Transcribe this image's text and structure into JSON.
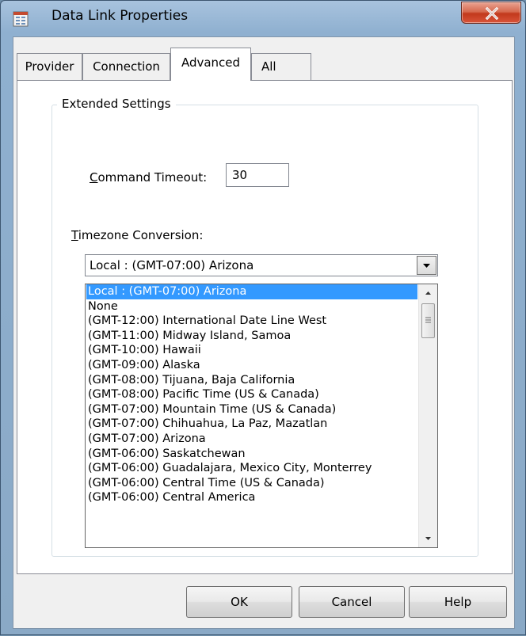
{
  "window": {
    "title": "Data Link Properties",
    "close_glyph": "X"
  },
  "tabs": [
    {
      "label": "Provider",
      "active": false
    },
    {
      "label": "Connection",
      "active": false
    },
    {
      "label": "Advanced",
      "active": true
    },
    {
      "label": "All",
      "active": false
    }
  ],
  "extended_settings": {
    "legend": "Extended Settings",
    "command_timeout": {
      "mnemonic": "C",
      "label_rest": "ommand Timeout:",
      "value": "30"
    },
    "timezone_conversion": {
      "mnemonic": "T",
      "label_rest": "imezone Conversion:",
      "selected": "Local : (GMT-07:00) Arizona",
      "options": [
        "Local : (GMT-07:00) Arizona",
        "None",
        "(GMT-12:00) International Date Line West",
        "(GMT-11:00) Midway Island, Samoa",
        "(GMT-10:00) Hawaii",
        "(GMT-09:00) Alaska",
        "(GMT-08:00) Tijuana, Baja California",
        "(GMT-08:00) Pacific Time (US & Canada)",
        "(GMT-07:00) Mountain Time (US & Canada)",
        "(GMT-07:00) Chihuahua, La Paz, Mazatlan",
        "(GMT-07:00) Arizona",
        "(GMT-06:00) Saskatchewan",
        "(GMT-06:00) Guadalajara, Mexico City, Monterrey",
        "(GMT-06:00) Central Time (US & Canada)",
        "(GMT-06:00) Central America"
      ]
    }
  },
  "buttons": {
    "ok": "OK",
    "cancel": "Cancel",
    "help": "Help"
  },
  "colors": {
    "selection": "#3399ff",
    "close_button": "#c7432a"
  },
  "icons": [
    "data-link-icon",
    "close-icon",
    "dropdown-arrow-icon",
    "scroll-up-icon",
    "scroll-down-icon",
    "scroll-grip-icon"
  ]
}
